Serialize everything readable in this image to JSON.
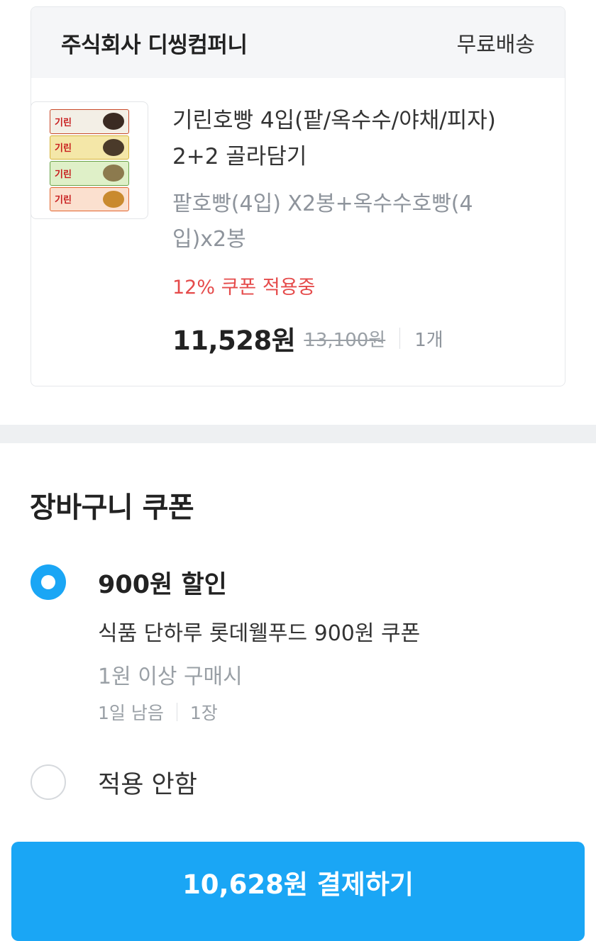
{
  "seller": {
    "name": "주식회사 디씽컴퍼니",
    "shipping": "무료배송"
  },
  "product": {
    "title": "기린호빵 4입(팥/옥수수/야채/피자) 2+2 골라담기",
    "option": "팥호빵(4입) X2봉+옥수수호빵(4입)x2봉",
    "coupon_status": "12% 쿠폰 적용중",
    "price": "11,528원",
    "original_price": "13,100원",
    "quantity": "1개",
    "thumbnail_label": "기린"
  },
  "cart_coupon": {
    "title": "장바구니 쿠폰",
    "options": [
      {
        "name": "900원 할인",
        "description": "식품 단하루 롯데웰푸드 900원 쿠폰",
        "condition": "1원 이상 구매시",
        "remaining": "1일 남음",
        "count": "1장",
        "selected": true
      },
      {
        "name": "적용 안함",
        "selected": false
      }
    ]
  },
  "payment": {
    "button_label": "10,628원 결제하기"
  },
  "colors": {
    "accent": "#1aa6f5",
    "coupon_red": "#e54b4b",
    "muted": "#9aa0a6"
  }
}
